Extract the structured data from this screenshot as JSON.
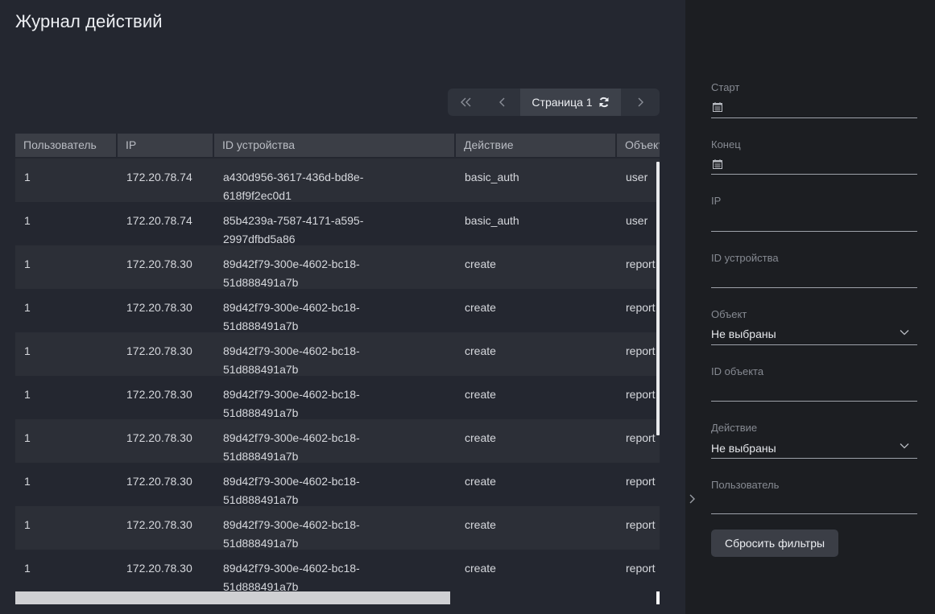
{
  "title": "Журнал действий",
  "pager": {
    "first_icon": "double-chevron-left-icon",
    "prev_icon": "chevron-left-icon",
    "current_label": "Страница 1",
    "refresh_icon": "refresh-icon",
    "next_icon": "chevron-right-icon"
  },
  "table": {
    "columns": [
      "Пользователь",
      "IP",
      "ID устройства",
      "Действие",
      "Объект"
    ],
    "rows": [
      {
        "user": "1",
        "ip": "172.20.78.74",
        "device_l1": "a430d956-3617-436d-bd8e-",
        "device_l2": "618f9f2ec0d1",
        "action": "basic_auth",
        "object": "user"
      },
      {
        "user": "1",
        "ip": "172.20.78.74",
        "device_l1": "85b4239a-7587-4171-a595-",
        "device_l2": "2997dfbd5a86",
        "action": "basic_auth",
        "object": "user"
      },
      {
        "user": "1",
        "ip": "172.20.78.30",
        "device_l1": "89d42f79-300e-4602-bc18-",
        "device_l2": "51d888491a7b",
        "action": "create",
        "object": "report"
      },
      {
        "user": "1",
        "ip": "172.20.78.30",
        "device_l1": "89d42f79-300e-4602-bc18-",
        "device_l2": "51d888491a7b",
        "action": "create",
        "object": "report"
      },
      {
        "user": "1",
        "ip": "172.20.78.30",
        "device_l1": "89d42f79-300e-4602-bc18-",
        "device_l2": "51d888491a7b",
        "action": "create",
        "object": "report"
      },
      {
        "user": "1",
        "ip": "172.20.78.30",
        "device_l1": "89d42f79-300e-4602-bc18-",
        "device_l2": "51d888491a7b",
        "action": "create",
        "object": "report"
      },
      {
        "user": "1",
        "ip": "172.20.78.30",
        "device_l1": "89d42f79-300e-4602-bc18-",
        "device_l2": "51d888491a7b",
        "action": "create",
        "object": "report"
      },
      {
        "user": "1",
        "ip": "172.20.78.30",
        "device_l1": "89d42f79-300e-4602-bc18-",
        "device_l2": "51d888491a7b",
        "action": "create",
        "object": "report"
      },
      {
        "user": "1",
        "ip": "172.20.78.30",
        "device_l1": "89d42f79-300e-4602-bc18-",
        "device_l2": "51d888491a7b",
        "action": "create",
        "object": "report"
      },
      {
        "user": "1",
        "ip": "172.20.78.30",
        "device_l1": "89d42f79-300e-4602-bc18-",
        "device_l2": "51d888491a7b",
        "action": "create",
        "object": "report"
      }
    ]
  },
  "filters": {
    "start_label": "Старт",
    "start_value": "",
    "end_label": "Конец",
    "end_value": "",
    "ip_label": "IP",
    "ip_value": "",
    "device_label": "ID устройства",
    "device_value": "",
    "object_label": "Объект",
    "object_value": "Не выбраны",
    "object_id_label": "ID объекта",
    "object_id_value": "",
    "action_label": "Действие",
    "action_value": "Не выбраны",
    "user_label": "Пользователь",
    "user_value": "",
    "reset_label": "Сбросить фильтры"
  },
  "colors": {
    "background": "#242730",
    "sidebar": "#1c1e22",
    "header": "#3b3e46",
    "row_alt": "#2c2f37"
  }
}
